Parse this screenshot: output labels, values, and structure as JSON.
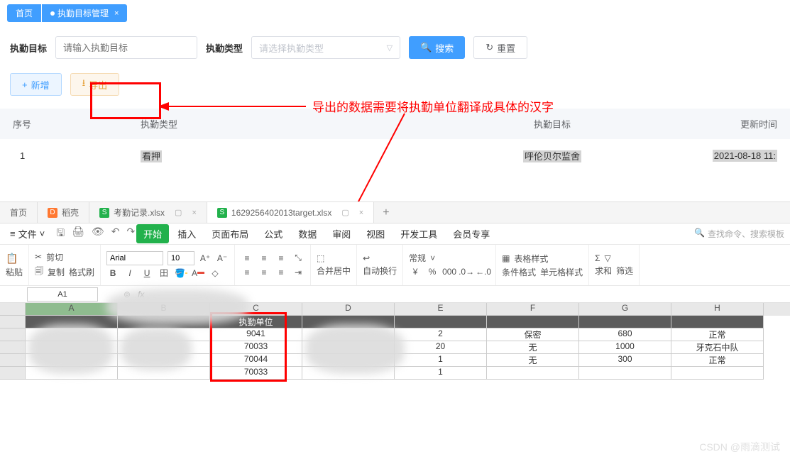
{
  "topTabs": {
    "home": "首页",
    "active": "执勤目标管理"
  },
  "search": {
    "targetLabel": "执勤目标",
    "targetPlaceholder": "请输入执勤目标",
    "typeLabel": "执勤类型",
    "typePlaceholder": "请选择执勤类型",
    "searchBtn": "搜索",
    "resetBtn": "重置"
  },
  "actions": {
    "add": "新增",
    "export": "导出"
  },
  "annotation": "导出的数据需要将执勤单位翻译成具体的汉字",
  "tableHead": {
    "seq": "序号",
    "type": "执勤类型",
    "target": "执勤目标",
    "time": "更新时间"
  },
  "tableRow": {
    "seq": "1",
    "type": "看押",
    "target": "呼伦贝尔监舍",
    "time": "2021-08-18 11:"
  },
  "sheetTabs": {
    "home": "首页",
    "doc1": "稻壳",
    "doc2": "考勤记录.xlsx",
    "doc3": "1629256402013target.xlsx"
  },
  "ribbon": {
    "file": "文件",
    "items": [
      "开始",
      "插入",
      "页面布局",
      "公式",
      "数据",
      "审阅",
      "视图",
      "开发工具",
      "会员专享"
    ],
    "searchPlaceholder": "查找命令、搜索模板"
  },
  "toolbar": {
    "cut": "剪切",
    "copy": "复制",
    "paste": "粘贴",
    "brush": "格式刷",
    "font": "Arial",
    "size": "10",
    "merge": "合并居中",
    "wrap": "自动换行",
    "numfmt": "常规",
    "condfmt": "条件格式",
    "tblstyle": "表格样式",
    "cellstyle": "单元格样式",
    "sum": "求和",
    "filter": "筛选"
  },
  "fx": {
    "cell": "A1"
  },
  "cols": [
    "A",
    "B",
    "C",
    "D",
    "E",
    "F",
    "G",
    "H"
  ],
  "sheetHeader": {
    "c": "执勤单位"
  },
  "sheetRows": [
    {
      "c": "9041",
      "e": "2",
      "f": "保密",
      "g": "680",
      "h": "正常"
    },
    {
      "c": "70033",
      "e": "20",
      "f": "无",
      "g": "1000",
      "h": "牙克石中队"
    },
    {
      "c": "70044",
      "e": "1",
      "f": "无",
      "g": "300",
      "h": "正常"
    },
    {
      "c": "70033",
      "e": "1",
      "f": "",
      "g": "",
      "h": ""
    }
  ],
  "watermark": "CSDN @雨滴测试"
}
